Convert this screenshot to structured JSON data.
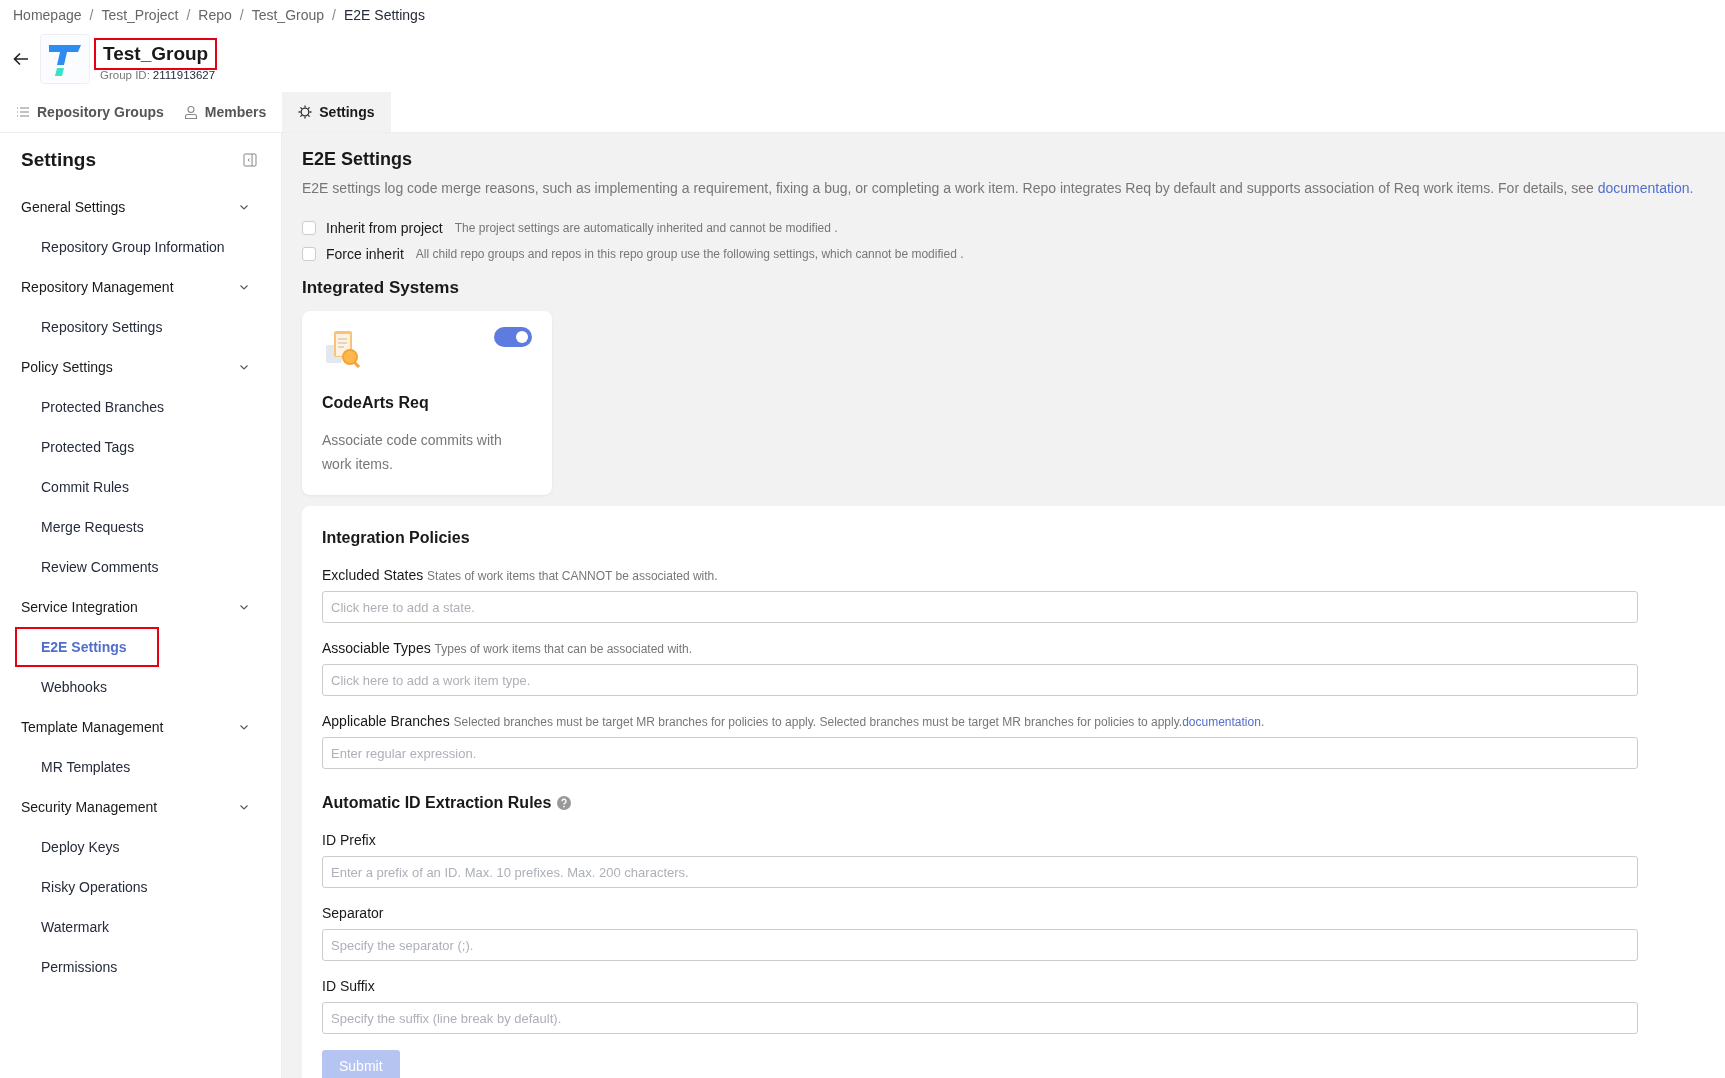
{
  "breadcrumb": [
    {
      "label": "Homepage",
      "kind": "link"
    },
    {
      "label": "/",
      "kind": "separator"
    },
    {
      "label": "Test_Project",
      "kind": "link"
    },
    {
      "label": "/",
      "kind": "separator"
    },
    {
      "label": "Repo",
      "kind": "link"
    },
    {
      "label": "/",
      "kind": "separator"
    },
    {
      "label": "Test_Group",
      "kind": "link"
    },
    {
      "label": "/",
      "kind": "separator"
    },
    {
      "label": "E2E Settings",
      "kind": "current"
    }
  ],
  "header": {
    "title": "Test_Group",
    "title_highlighted": true,
    "id_label": "Group ID:",
    "id_value": "2111913627"
  },
  "tabs": [
    {
      "label": "Repository Groups",
      "selected": false
    },
    {
      "label": "Members",
      "selected": false
    },
    {
      "label": "Settings",
      "selected": true
    }
  ],
  "sidebar": {
    "title": "Settings",
    "groups": [
      {
        "label": "General Settings",
        "expanded": true,
        "items": [
          {
            "label": "Repository Group Information",
            "selected": false,
            "highlighted": false
          }
        ]
      },
      {
        "label": "Repository Management",
        "expanded": true,
        "items": [
          {
            "label": "Repository Settings",
            "selected": false,
            "highlighted": false
          }
        ]
      },
      {
        "label": "Policy Settings",
        "expanded": true,
        "items": [
          {
            "label": "Protected Branches",
            "selected": false,
            "highlighted": false
          },
          {
            "label": "Protected Tags",
            "selected": false,
            "highlighted": false
          },
          {
            "label": "Commit Rules",
            "selected": false,
            "highlighted": false
          },
          {
            "label": "Merge Requests",
            "selected": false,
            "highlighted": false
          },
          {
            "label": "Review Comments",
            "selected": false,
            "highlighted": false
          }
        ]
      },
      {
        "label": "Service Integration",
        "expanded": true,
        "items": [
          {
            "label": "E2E Settings",
            "selected": true,
            "highlighted": true
          },
          {
            "label": "Webhooks",
            "selected": false,
            "highlighted": false
          }
        ]
      },
      {
        "label": "Template Management",
        "expanded": true,
        "items": [
          {
            "label": "MR Templates",
            "selected": false,
            "highlighted": false
          }
        ]
      },
      {
        "label": "Security Management",
        "expanded": true,
        "items": [
          {
            "label": "Deploy Keys",
            "selected": false,
            "highlighted": false
          },
          {
            "label": "Risky Operations",
            "selected": false,
            "highlighted": false
          },
          {
            "label": "Watermark",
            "selected": false,
            "highlighted": false
          },
          {
            "label": "Permissions",
            "selected": false,
            "highlighted": false
          }
        ]
      }
    ]
  },
  "main": {
    "title": "E2E Settings",
    "description": "E2E settings log code merge reasons, such as implementing a requirement, fixing a bug, or completing a work item. Repo integrates Req by default and supports association of Req work items. For details, see ",
    "description_link": "documentation",
    "description_end": ".",
    "options": [
      {
        "label": "Inherit from project",
        "hint": "The project settings are automatically inherited and cannot be modified .",
        "checked": false
      },
      {
        "label": "Force inherit",
        "hint": "All child repo groups and repos in this repo group use the following settings, which cannot be modified .",
        "checked": false
      }
    ],
    "systems_title": "Integrated Systems",
    "systems": [
      {
        "name": "CodeArts Req",
        "description": "Associate code commits with work items.",
        "on": true
      }
    ],
    "policies": {
      "title": "Integration Policies",
      "fields": [
        {
          "label": "Excluded States",
          "hint": "States of work items that CANNOT be associated with.",
          "placeholder": "Click here to add a state."
        },
        {
          "label": "Associable Types",
          "hint": "Types of work items that can be associated with.",
          "placeholder": "Click here to add a work item type."
        },
        {
          "label": "Applicable Branches",
          "hint": "Selected branches must be target MR branches for policies to apply. Selected branches must be target MR branches for policies to apply.",
          "link": "documentation",
          "link_end": ".",
          "placeholder": "Enter regular expression."
        }
      ]
    },
    "extraction": {
      "title": "Automatic ID Extraction Rules",
      "fields": [
        {
          "label": "ID Prefix",
          "placeholder": "Enter a prefix of an ID. Max. 10 prefixes. Max. 200 characters."
        },
        {
          "label": "Separator",
          "placeholder": "Specify the separator (;)."
        },
        {
          "label": "ID Suffix",
          "placeholder": "Specify the suffix (line break by default)."
        }
      ]
    },
    "submit": {
      "label": "Submit",
      "disabled": true
    }
  }
}
